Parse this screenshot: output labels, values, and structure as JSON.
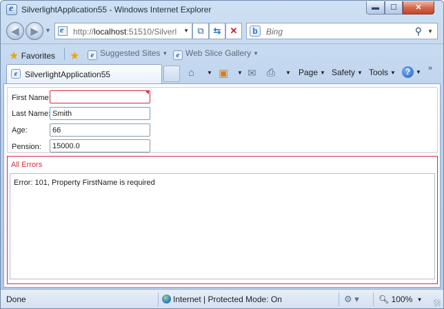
{
  "window": {
    "title": "SilverlightApplication55 - Windows Internet Explorer",
    "min_glyph": "▬",
    "max_glyph": "☐",
    "close_glyph": "✕"
  },
  "nav": {
    "back_glyph": "◀",
    "forward_glyph": "▶",
    "dropdown_glyph": "▼"
  },
  "address": {
    "url_dim_1": "http://",
    "url_host": "localhost",
    "url_dim_2": ":51510/Silverl"
  },
  "search": {
    "placeholder": "Bing",
    "logo_letter": "b"
  },
  "favorites": {
    "favorites_label": "Favorites",
    "suggested_sites": "Suggested Sites",
    "web_slice_gallery": "Web Slice Gallery"
  },
  "tab": {
    "label": "SilverlightApplication55"
  },
  "commands": {
    "page": "Page",
    "safety": "Safety",
    "tools": "Tools",
    "help": "?",
    "more": "»"
  },
  "form": {
    "first_name_label": "First Name:",
    "first_name_value": "",
    "last_name_label": "Last Name:",
    "last_name_value": "Smith",
    "age_label": "Age:",
    "age_value": "66",
    "pension_label": "Pension:",
    "pension_value": "15000.0"
  },
  "errors": {
    "title": "All Errors",
    "items": [
      "Error: 101, Property FirstName is required"
    ]
  },
  "status": {
    "done": "Done",
    "zone": "Internet | Protected Mode: On",
    "zoom": "100%"
  },
  "colors": {
    "error_red": "#d8283c",
    "frame_blue": "#b9d1ec"
  },
  "icons": [
    "ie-icon",
    "back-icon",
    "forward-icon",
    "compat-view-icon",
    "refresh-icon",
    "stop-icon",
    "bing-icon",
    "search-icon",
    "star-icon",
    "add-favorite-icon",
    "home-icon",
    "rss-icon",
    "mail-icon",
    "print-icon",
    "help-icon",
    "globe-icon",
    "zoom-icon"
  ]
}
